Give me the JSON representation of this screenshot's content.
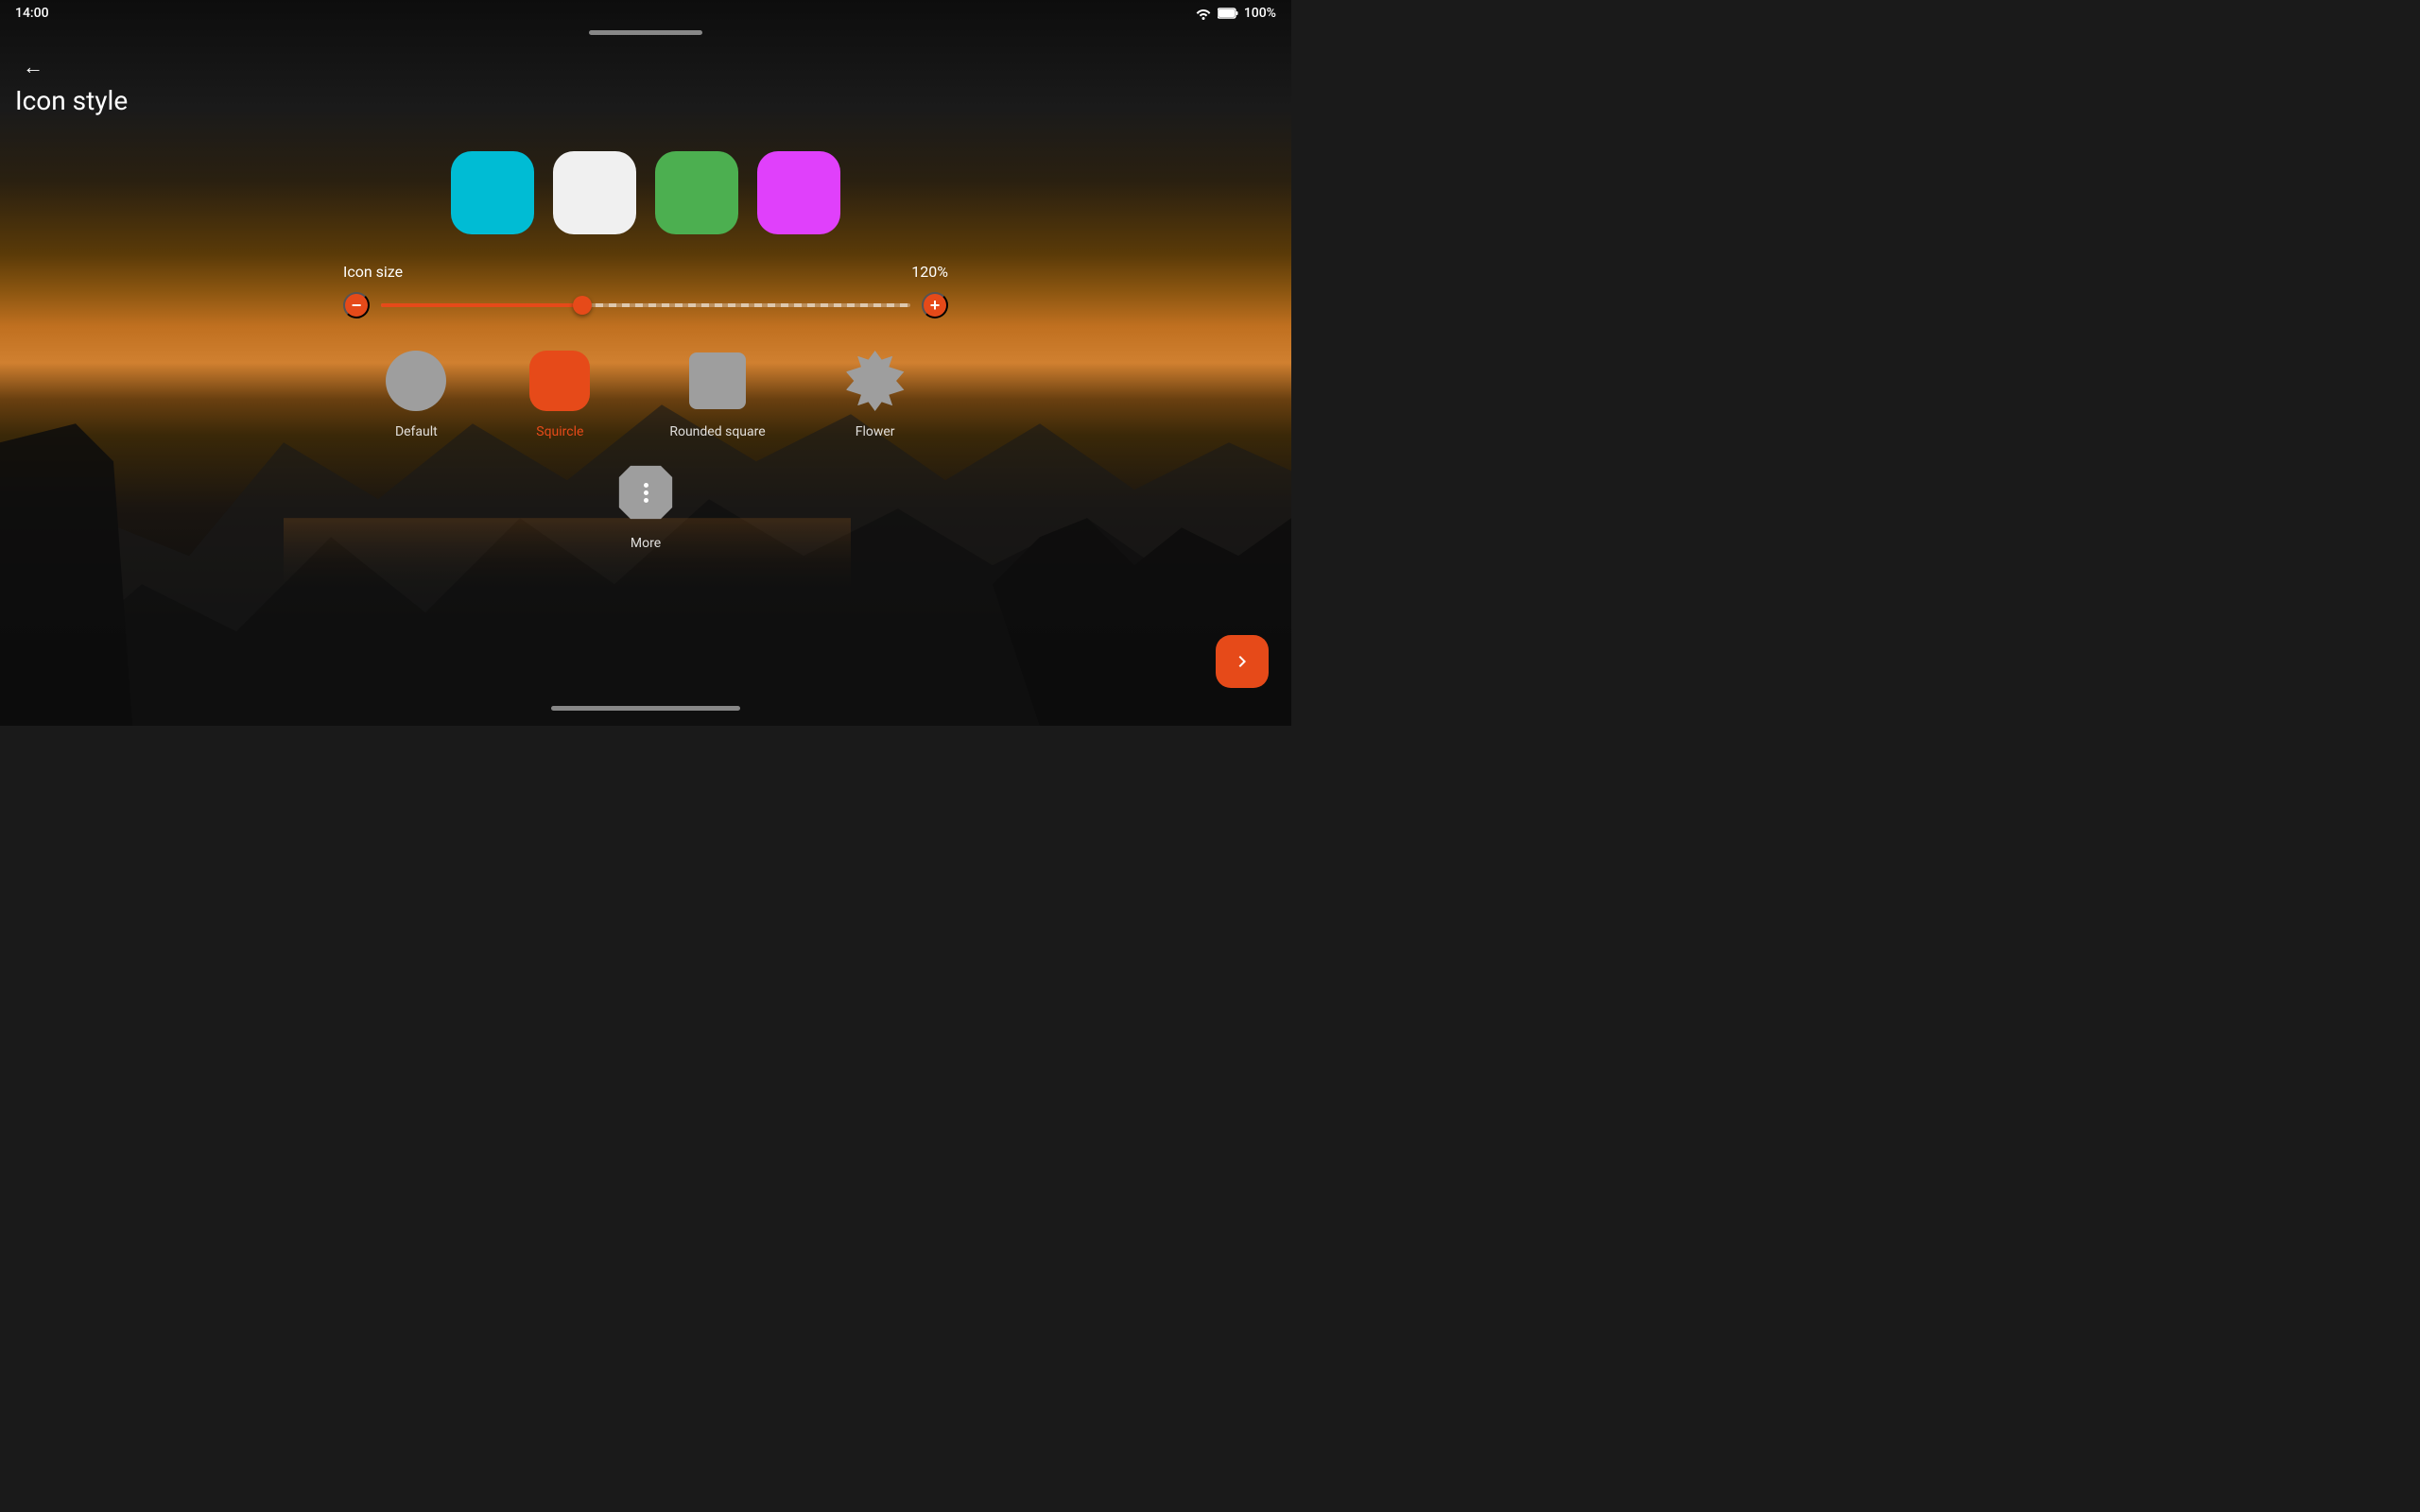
{
  "statusBar": {
    "time": "14:00",
    "battery": "100%"
  },
  "page": {
    "title": "Icon style",
    "back_label": "←"
  },
  "colorSwatches": [
    {
      "id": "cyan",
      "color": "#00bcd4",
      "label": "Cyan"
    },
    {
      "id": "white",
      "color": "#f0f0f0",
      "label": "White"
    },
    {
      "id": "green",
      "color": "#4caf50",
      "label": "Green"
    },
    {
      "id": "magenta",
      "color": "#e040fb",
      "label": "Magenta"
    }
  ],
  "iconSize": {
    "label": "Icon size",
    "value": "120%",
    "sliderPercent": 38,
    "minus_label": "−",
    "plus_label": "+"
  },
  "iconStyles": {
    "row1": [
      {
        "id": "default",
        "label": "Default",
        "shape": "circle",
        "active": false
      },
      {
        "id": "squircle",
        "label": "Squircle",
        "shape": "squircle",
        "active": true
      },
      {
        "id": "rounded-square",
        "label": "Rounded square",
        "shape": "rounded-square",
        "active": false
      },
      {
        "id": "flower",
        "label": "Flower",
        "shape": "flower",
        "active": false
      }
    ],
    "row2": [
      {
        "id": "more",
        "label": "More",
        "shape": "more",
        "active": false
      }
    ]
  },
  "navigation": {
    "forward_label": "→"
  }
}
